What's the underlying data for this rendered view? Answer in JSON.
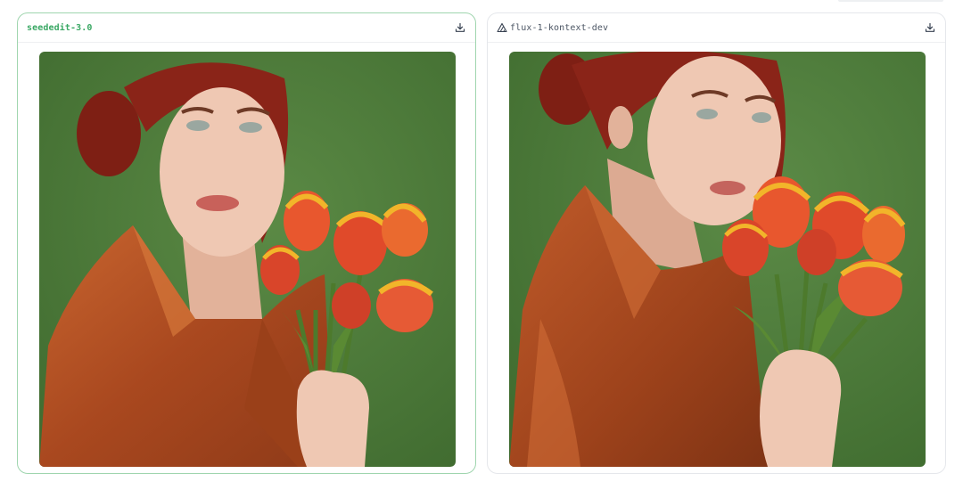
{
  "results": [
    {
      "model_name": "seededit-3.0",
      "selected": true,
      "download_icon": "download-icon",
      "image_alt": "Portrait of a red-haired woman in a rust satin robe holding orange-yellow tulips against a green background"
    },
    {
      "model_name": "flux-1-kontext-dev",
      "selected": false,
      "provider_icon": "triangle-logo-icon",
      "download_icon": "download-icon",
      "image_alt": "Portrait of a red-haired woman in a rust satin robe smelling orange-yellow tulips against a green background"
    }
  ],
  "colors": {
    "selected_border": "#9fd5ae",
    "selected_label": "#3aa864",
    "background_green": "#4f7a3c",
    "robe": "#b9542a",
    "hair": "#8a2418",
    "skin": "#ecc3ad",
    "tulip": "#e8572e",
    "tulip_edge": "#f2b52a",
    "stem": "#4d7a2c"
  }
}
